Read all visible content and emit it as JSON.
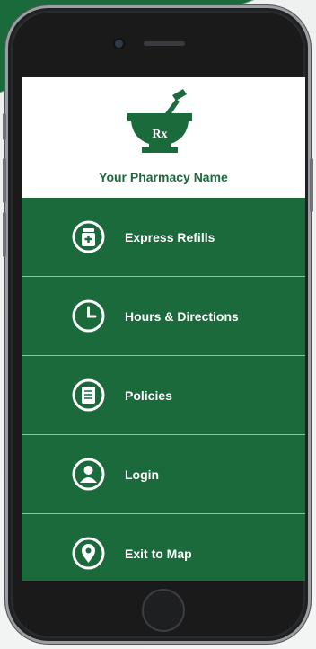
{
  "colors": {
    "brand_green": "#1b6a3c",
    "header_bg": "#ffffff",
    "text_light": "#ffffff"
  },
  "header": {
    "logo_icon": "mortar-pestle-rx-icon",
    "logo_text": "Rx",
    "pharmacy_name": "Your Pharmacy Name"
  },
  "menu": {
    "items": [
      {
        "icon": "pill-bottle-icon",
        "label": "Express Refills"
      },
      {
        "icon": "clock-icon",
        "label": "Hours & Directions"
      },
      {
        "icon": "document-icon",
        "label": "Policies"
      },
      {
        "icon": "user-icon",
        "label": "Login"
      },
      {
        "icon": "map-pin-icon",
        "label": "Exit to Map"
      }
    ]
  }
}
